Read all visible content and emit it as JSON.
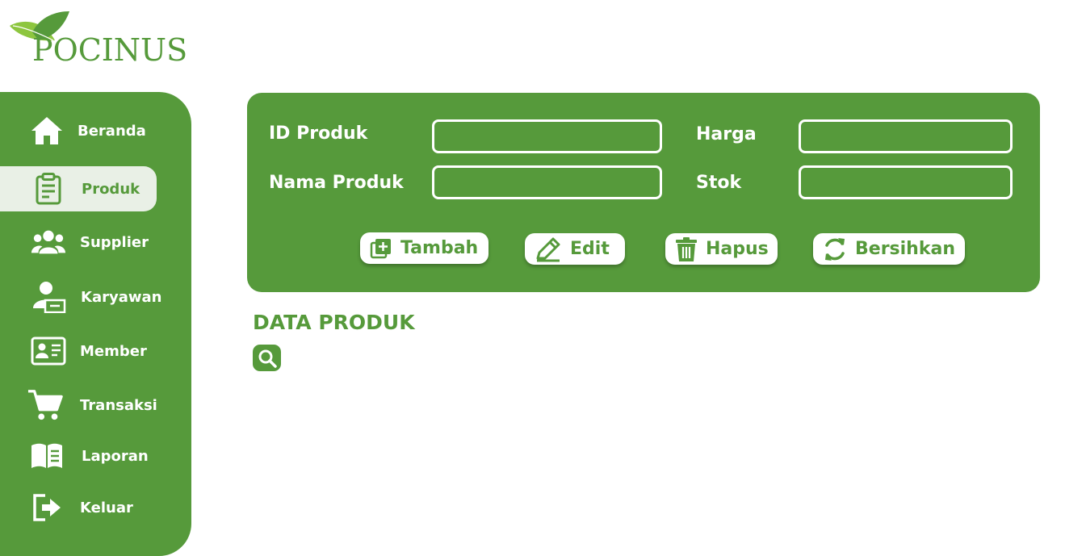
{
  "brand": {
    "name": "POCINUS",
    "color": "#569a3b"
  },
  "sidebar": {
    "items": [
      {
        "label": "Beranda",
        "icon": "home-icon"
      },
      {
        "label": "Produk",
        "icon": "clipboard-icon",
        "active": true
      },
      {
        "label": "Supplier",
        "icon": "users-icon"
      },
      {
        "label": "Karyawan",
        "icon": "employee-icon"
      },
      {
        "label": "Member",
        "icon": "id-card-icon"
      },
      {
        "label": "Transaksi",
        "icon": "cart-icon"
      },
      {
        "label": "Laporan",
        "icon": "book-icon"
      },
      {
        "label": "Keluar",
        "icon": "logout-icon"
      }
    ]
  },
  "form": {
    "id_label": "ID Produk",
    "id_value": "",
    "name_label": "Nama Produk",
    "name_value": "",
    "price_label": "Harga",
    "price_value": "",
    "stock_label": "Stok",
    "stock_value": ""
  },
  "actions": {
    "add": "Tambah",
    "edit": "Edit",
    "delete": "Hapus",
    "clear": "Bersihkan"
  },
  "data_section": {
    "title": "DATA PRODUK",
    "search_icon": "search-icon"
  }
}
